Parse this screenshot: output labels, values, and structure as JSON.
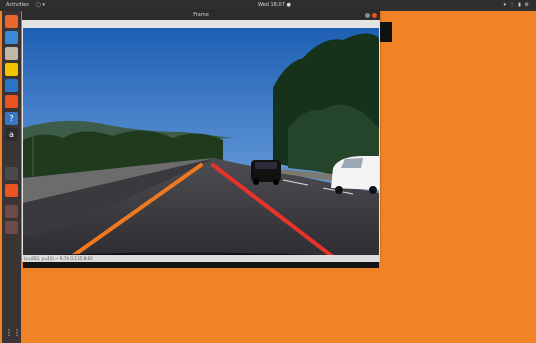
{
  "topbar": {
    "activities": "Activities",
    "app_menu": "▢ ▾",
    "clock": "Wed 18:07 ●",
    "tray": "▾ ⋮ ▮ ⚙"
  },
  "dock": {
    "items": [
      {
        "name": "firefox-icon",
        "glyph": "",
        "color": "#e8672c"
      },
      {
        "name": "thunderbird-icon",
        "glyph": "",
        "color": "#3c8ad8"
      },
      {
        "name": "files-icon",
        "glyph": "",
        "color": "#bfb7a8"
      },
      {
        "name": "music-icon",
        "glyph": "",
        "color": "#f5c400"
      },
      {
        "name": "writer-icon",
        "glyph": "",
        "color": "#2a74c9"
      },
      {
        "name": "software-center-icon",
        "glyph": "",
        "color": "#e95420"
      },
      {
        "name": "help-icon",
        "glyph": "?",
        "color": "#3a76c4"
      },
      {
        "name": "amazon-icon",
        "glyph": "a",
        "color": "#2d2d2d"
      },
      {
        "name": "terminal-icon",
        "glyph": "",
        "color": "#4a4a4a"
      },
      {
        "name": "ubuntu-icon",
        "glyph": "",
        "color": "#e95420"
      },
      {
        "name": "app-icon-1",
        "glyph": "",
        "color": "#6e4a48"
      },
      {
        "name": "app-icon-2",
        "glyph": "",
        "color": "#6e4a48"
      },
      {
        "name": "show-apps-icon",
        "glyph": "⋮⋮",
        "color": "#3b3434"
      }
    ]
  },
  "window": {
    "title": "Frame",
    "status": "(x=852, y=41) ~ R:74 G:135 B:82"
  },
  "colors": {
    "desktop": "#f08326",
    "lane_left": "#f0781e",
    "lane_right": "#e8332b"
  }
}
